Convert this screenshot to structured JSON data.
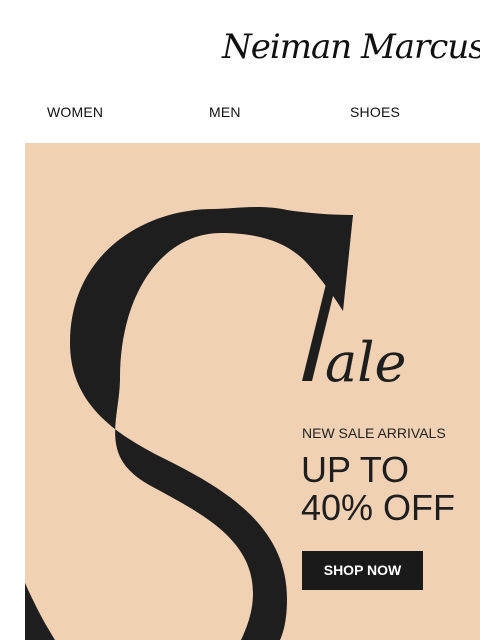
{
  "brand": {
    "name": "Neiman Marcus"
  },
  "nav": {
    "items": [
      {
        "label": "WOMEN"
      },
      {
        "label": "MEN"
      },
      {
        "label": "SHOES"
      }
    ]
  },
  "hero": {
    "headline": "Sale",
    "subtitle": "NEW SALE ARRIVALS",
    "offer_line1": "UP TO",
    "offer_line2": "40% OFF",
    "cta_label": "SHOP NOW",
    "colors": {
      "background": "#f0d1b3",
      "ink": "#1e1e1e",
      "button": "#1a1a1a",
      "button_text": "#ffffff"
    }
  }
}
